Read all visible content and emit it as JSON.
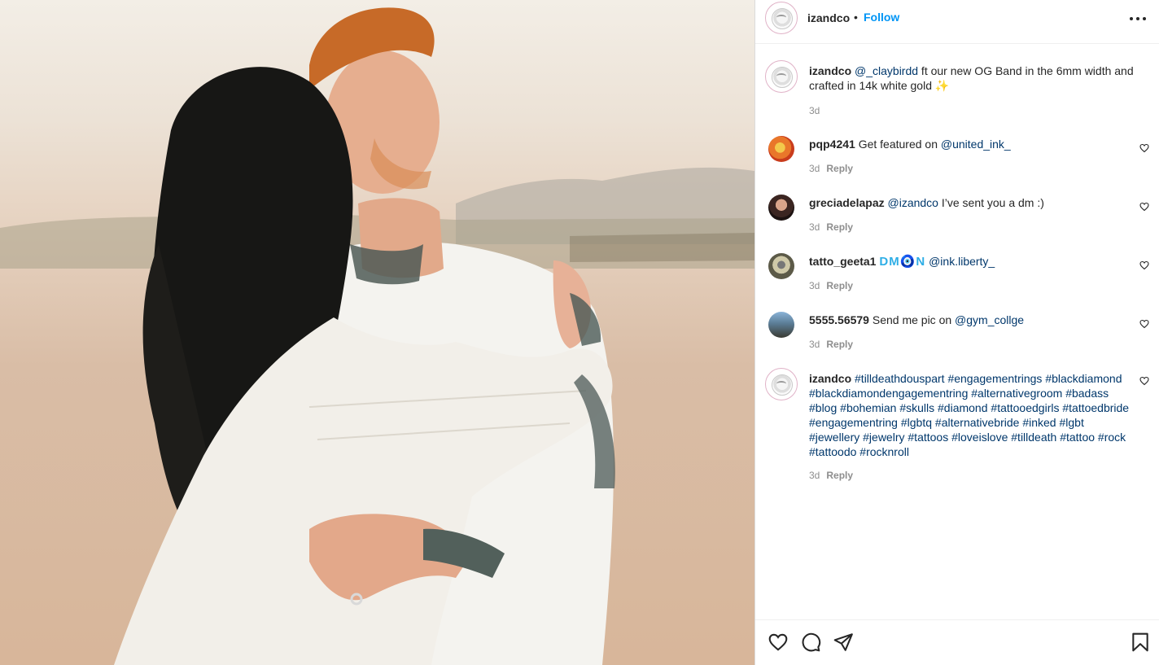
{
  "post": {
    "username": "izandco",
    "separator": "•",
    "follow_label": "Follow",
    "more_icon": "more-horizontal-icon"
  },
  "caption": {
    "username": "izandco",
    "mention": "@_claybirdd",
    "text": " ft our new OG Band in the 6mm width and crafted in 14k white gold ✨",
    "time": "3d"
  },
  "comments": [
    {
      "username": "pqp4241",
      "text_before": "Get featured on ",
      "mention": "@united_ink_",
      "text_after": "",
      "time": "3d",
      "reply": "Reply"
    },
    {
      "username": "greciadelapaz",
      "text_before": "",
      "mention": "@izandco",
      "text_after": " I’ve sent you a dm :)",
      "time": "3d",
      "reply": "Reply"
    },
    {
      "username": "tatto_geeta1",
      "emoji_text": "DM🧿N",
      "mention": "@ink.liberty_",
      "time": "3d",
      "reply": "Reply"
    },
    {
      "username": "5555.56579",
      "text_before": "Send me pic on ",
      "mention": "@gym_collge",
      "text_after": "",
      "time": "3d",
      "reply": "Reply"
    }
  ],
  "hashtag_comment": {
    "username": "izandco",
    "tags": [
      "#tilldeathdouspart",
      "#engagementrings",
      "#blackdiamond",
      "#blackdiamondengagementring",
      "#alternativegroom",
      "#badass",
      "#blog",
      "#bohemian",
      "#skulls",
      "#diamond",
      "#tattooedgirls",
      "#tattoedbride",
      "#engagementring",
      "#lgbtq",
      "#alternativebride",
      "#inked",
      "#lgbt",
      "#jewellery",
      "#jewelry",
      "#tattoos",
      "#loveislove",
      "#tilldeath",
      "#tattoo",
      "#rock",
      "#tattoodo",
      "#rocknroll"
    ],
    "time": "3d",
    "reply": "Reply"
  },
  "actions": {
    "like_icon": "heart-icon",
    "comment_icon": "comment-icon",
    "share_icon": "share-icon",
    "save_icon": "bookmark-icon"
  },
  "colors": {
    "link": "#0095f6",
    "mention": "#00376b",
    "muted": "#8e8e8e",
    "text": "#262626"
  }
}
